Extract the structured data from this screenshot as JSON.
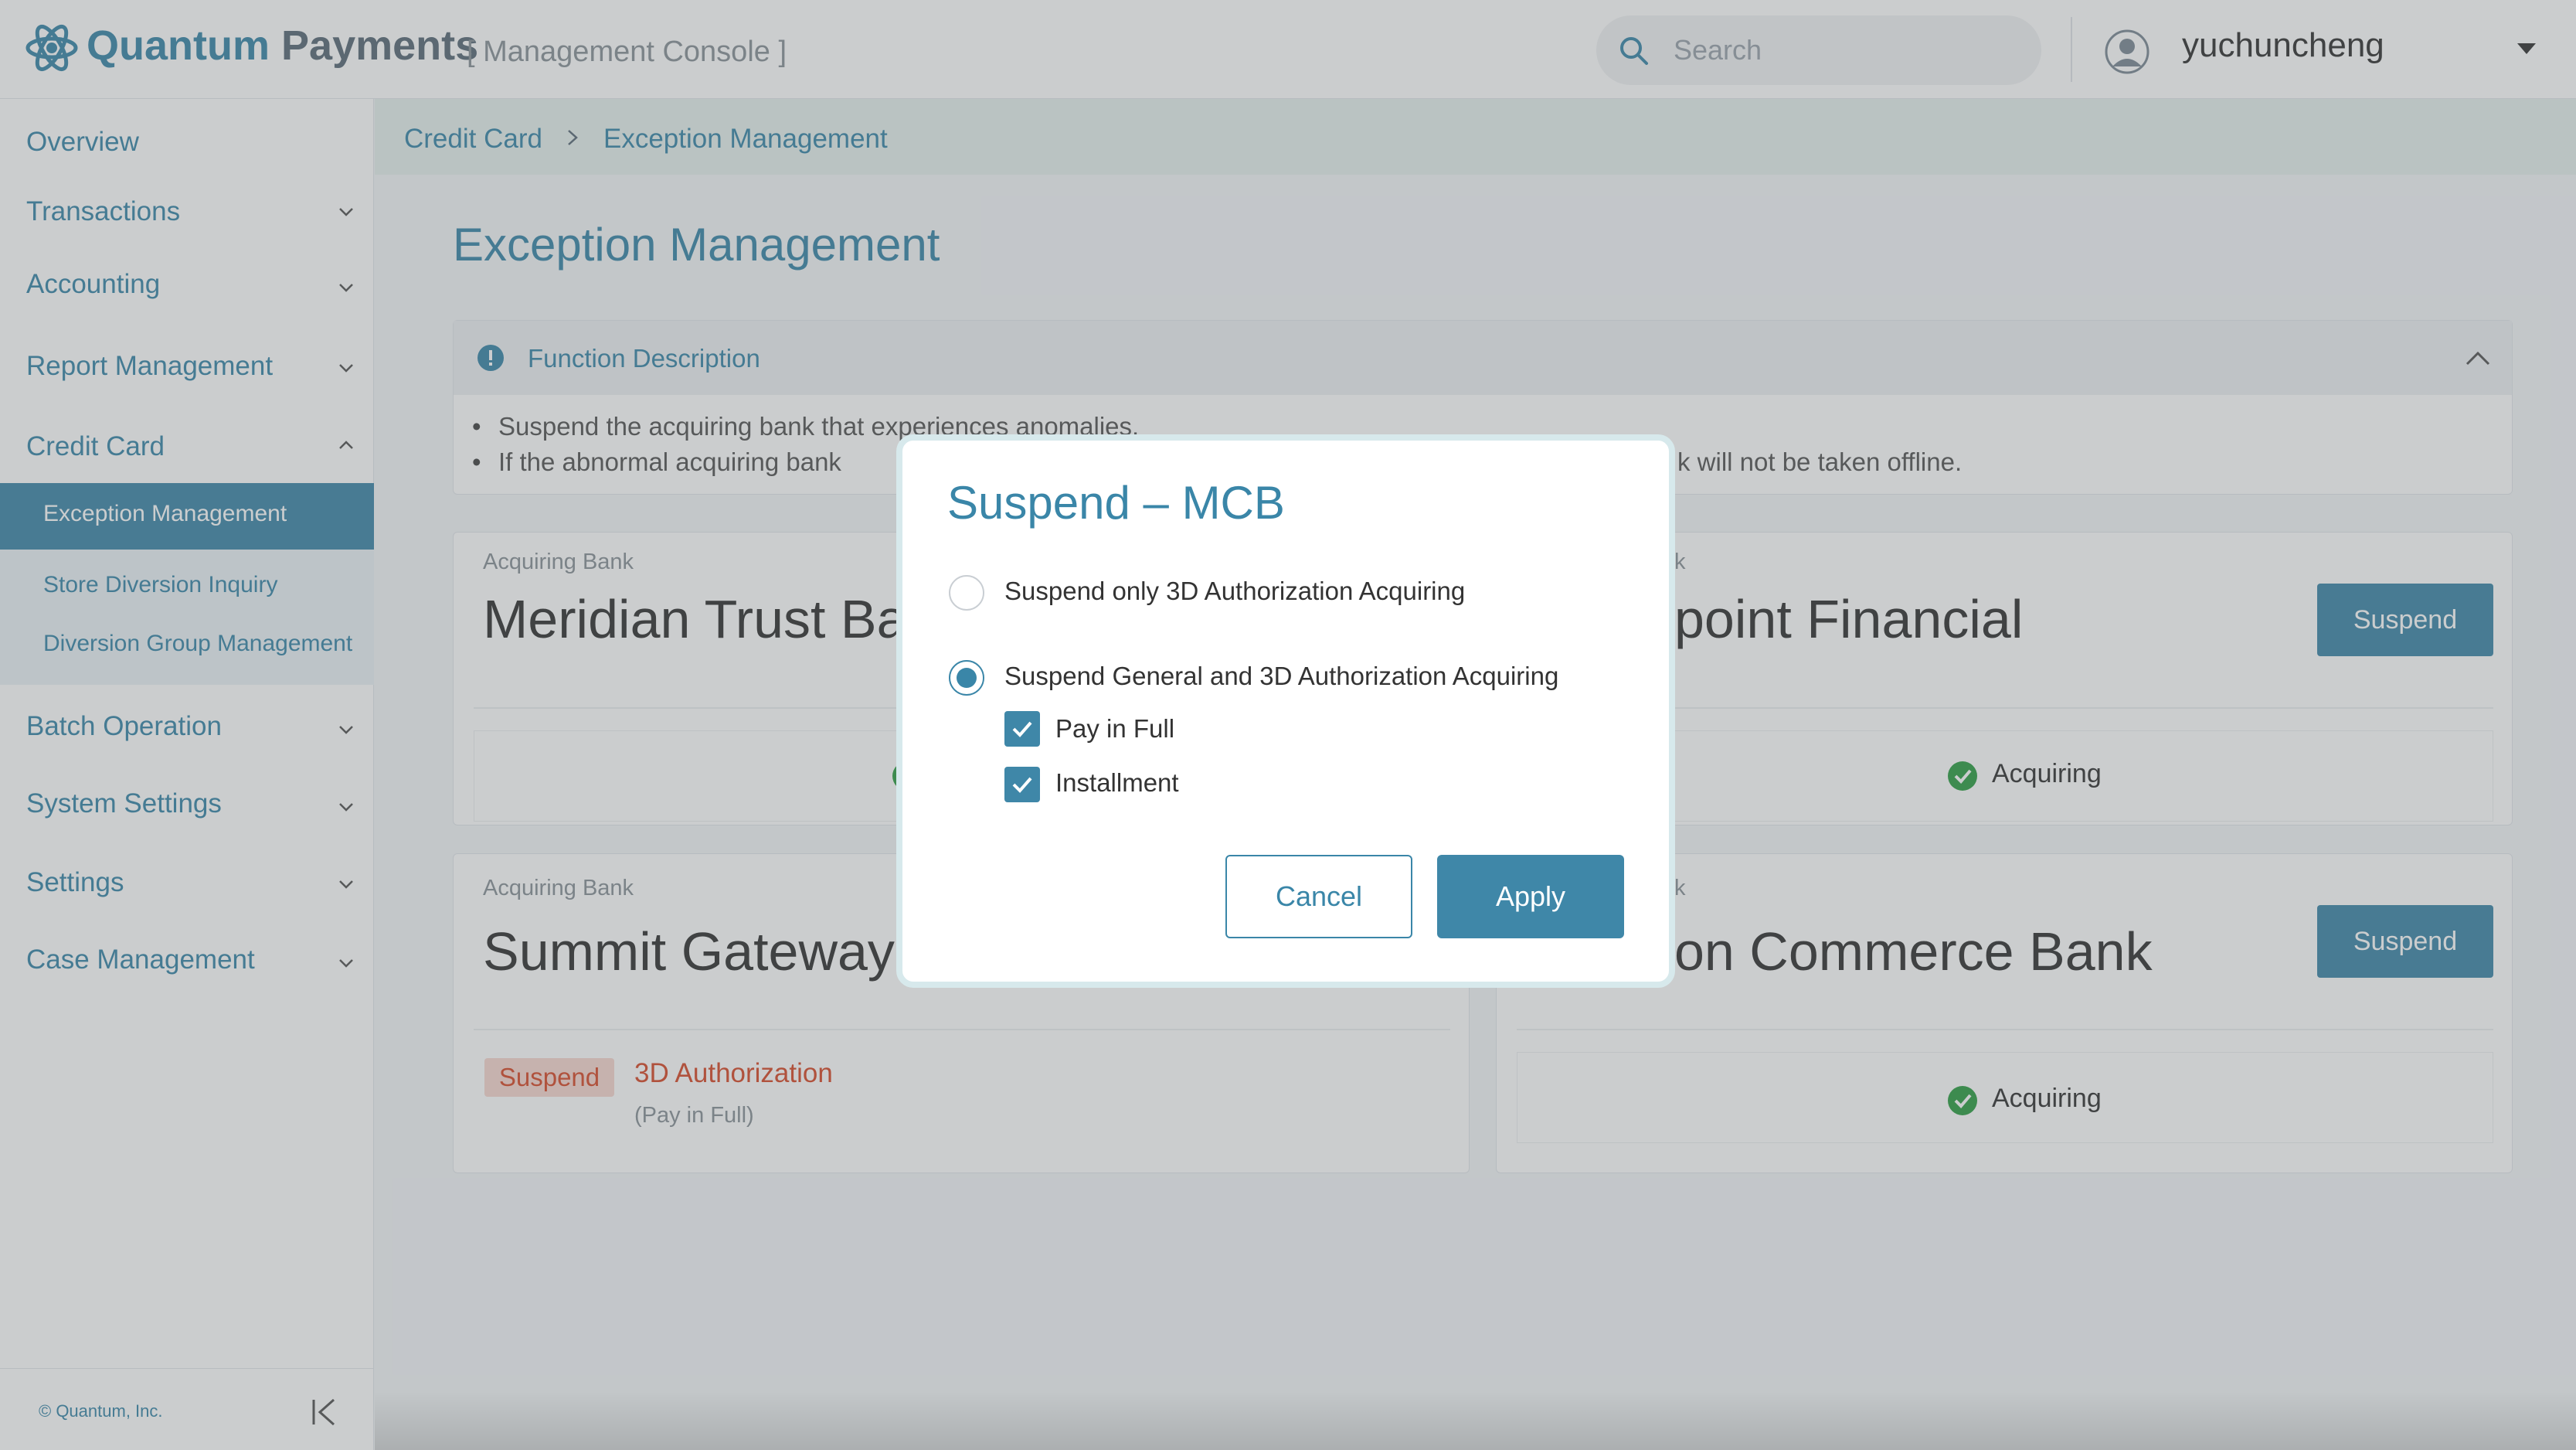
{
  "header": {
    "brand_primary": "Quantum",
    "brand_secondary": "Payments",
    "console_label": "[ Management Console ]",
    "search_placeholder": "Search",
    "username": "yuchuncheng"
  },
  "sidebar": {
    "items": [
      {
        "label": "Overview"
      },
      {
        "label": "Transactions"
      },
      {
        "label": "Accounting"
      },
      {
        "label": "Report Management"
      },
      {
        "label": "Credit Card"
      },
      {
        "label": "Batch Operation"
      },
      {
        "label": "System Settings"
      },
      {
        "label": "Settings"
      },
      {
        "label": "Case Management"
      }
    ],
    "credit_card_subitems": [
      {
        "label": "Exception Management"
      },
      {
        "label": "Store Diversion Inquiry"
      },
      {
        "label": "Diversion Group Management"
      }
    ],
    "footer": "© Quantum, Inc."
  },
  "breadcrumb": {
    "parent": "Credit Card",
    "current": "Exception Management"
  },
  "page": {
    "title": "Exception Management"
  },
  "function_description": {
    "title": "Function Description",
    "bullets": [
      "Suspend the acquiring bank that experiences anomalies.",
      "If the abnormal acquiring bank",
      "k will not be taken offline."
    ]
  },
  "cards": [
    {
      "label": "Acquiring Bank",
      "name": "Meridian Trust Ba",
      "status": ""
    },
    {
      "label": "k",
      "name": "point Financial",
      "button": "Suspend",
      "status": "Acquiring"
    },
    {
      "label": "Acquiring Bank",
      "name": "Summit Gateway",
      "tag": "Suspend",
      "tag_detail": "3D Authorization",
      "tag_note": "(Pay in Full)"
    },
    {
      "label": "k",
      "name": "on Commerce Bank",
      "button": "Suspend",
      "status": "Acquiring"
    }
  ],
  "dialog": {
    "title": "Suspend – MCB",
    "option_3d_only": "Suspend only 3D Authorization Acquiring",
    "option_general": "Suspend General and 3D Authorization Acquiring",
    "selected_option": "general",
    "checkbox_pay_in_full": "Pay in Full",
    "checkbox_installment": "Installment",
    "cancel_label": "Cancel",
    "apply_label": "Apply"
  },
  "colors": {
    "accent": "#3a86a8",
    "danger": "#d84a2a",
    "success": "#2e9e44"
  }
}
